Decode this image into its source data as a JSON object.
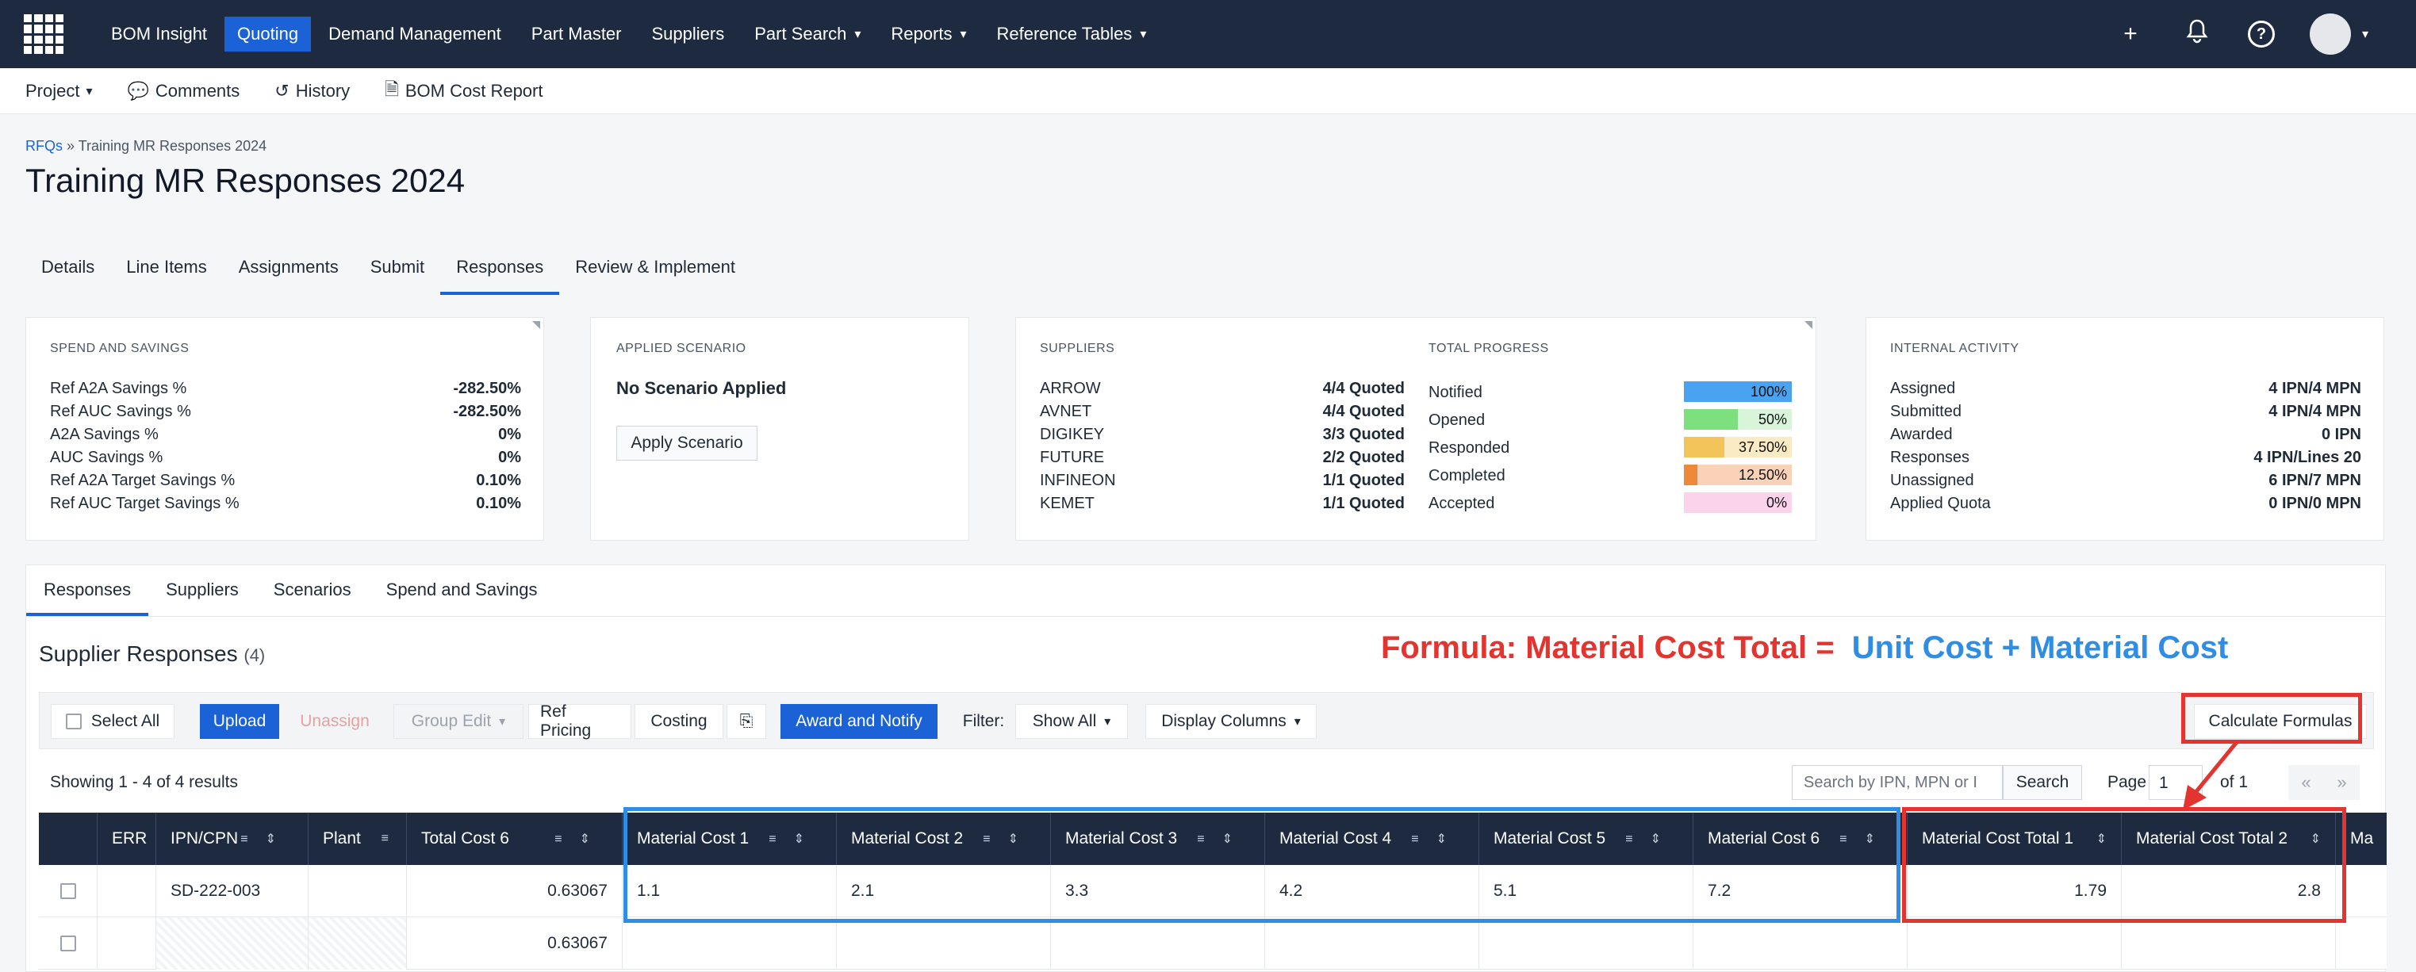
{
  "nav": {
    "items": [
      {
        "label": "BOM Insight",
        "chev": ""
      },
      {
        "label": "Quoting",
        "chev": ""
      },
      {
        "label": "Demand Management",
        "chev": ""
      },
      {
        "label": "Part Master",
        "chev": ""
      },
      {
        "label": "Suppliers",
        "chev": ""
      },
      {
        "label": "Part Search",
        "chev": "⌄"
      },
      {
        "label": "Reports",
        "chev": "⌄"
      },
      {
        "label": "Reference Tables",
        "chev": "⌄"
      }
    ],
    "active": "Quoting"
  },
  "subnav": {
    "project": "Project",
    "comments": "Comments",
    "history": "History",
    "bom_cost_report": "BOM Cost Report"
  },
  "breadcrumb": {
    "root": "RFQs",
    "sep": " » ",
    "current": "Training MR Responses 2024"
  },
  "title": "Training MR Responses 2024",
  "page_tabs": [
    "Details",
    "Line Items",
    "Assignments",
    "Submit",
    "Responses",
    "Review & Implement"
  ],
  "spend": {
    "heading": "SPEND AND SAVINGS",
    "rows": [
      {
        "k": "Ref A2A Savings %",
        "v": "-282.50%"
      },
      {
        "k": "Ref AUC Savings %",
        "v": "-282.50%"
      },
      {
        "k": "A2A Savings %",
        "v": "0%"
      },
      {
        "k": "AUC Savings %",
        "v": "0%"
      },
      {
        "k": "Ref A2A Target Savings %",
        "v": "0.10%"
      },
      {
        "k": "Ref AUC Target Savings %",
        "v": "0.10%"
      }
    ]
  },
  "scenario": {
    "heading": "APPLIED SCENARIO",
    "status": "No Scenario Applied",
    "button": "Apply Scenario"
  },
  "suppliers": {
    "heading": "SUPPLIERS",
    "rows": [
      {
        "k": "ARROW",
        "v": "4/4 Quoted"
      },
      {
        "k": "AVNET",
        "v": "4/4 Quoted"
      },
      {
        "k": "DIGIKEY",
        "v": "3/3 Quoted"
      },
      {
        "k": "FUTURE",
        "v": "2/2 Quoted"
      },
      {
        "k": "INFINEON",
        "v": "1/1 Quoted"
      },
      {
        "k": "KEMET",
        "v": "1/1 Quoted"
      }
    ]
  },
  "progress": {
    "heading": "TOTAL PROGRESS",
    "rows": [
      {
        "k": "Notified",
        "label": "100%",
        "pct": 100,
        "color": "#4aa3f0",
        "bg": "#dbeafe"
      },
      {
        "k": "Opened",
        "label": "50%",
        "pct": 50,
        "color": "#7ddf7d",
        "bg": "#d9f5d9"
      },
      {
        "k": "Responded",
        "label": "37.50%",
        "pct": 37.5,
        "color": "#f2c45a",
        "bg": "#fbebc4"
      },
      {
        "k": "Completed",
        "label": "12.50%",
        "pct": 12.5,
        "color": "#f0883a",
        "bg": "#f9d2b8"
      },
      {
        "k": "Accepted",
        "label": "0%",
        "pct": 0,
        "color": "#f7b6dd",
        "bg": "#fbd3ea"
      }
    ]
  },
  "internal": {
    "heading": "INTERNAL ACTIVITY",
    "rows": [
      {
        "k": "Assigned",
        "v": "4 IPN/4 MPN"
      },
      {
        "k": "Submitted",
        "v": "4 IPN/4 MPN"
      },
      {
        "k": "Awarded",
        "v": "0 IPN"
      },
      {
        "k": "Responses",
        "v": "4 IPN/Lines 20"
      },
      {
        "k": "Unassigned",
        "v": "6 IPN/7 MPN"
      },
      {
        "k": "Applied Quota",
        "v": "0 IPN/0 MPN"
      }
    ]
  },
  "sub_tabs": [
    "Responses",
    "Suppliers",
    "Scenarios",
    "Spend and Savings"
  ],
  "section": {
    "title": "Supplier Responses",
    "count": "(4)"
  },
  "formula": {
    "left": "Formula: Material Cost Total =",
    "right": "Unit Cost + Material Cost"
  },
  "toolbar": {
    "select_all": "Select All",
    "upload": "Upload",
    "unassign": "Unassign",
    "group_edit": "Group Edit",
    "ref_pricing": "Ref Pricing",
    "costing": "Costing",
    "award": "Award and Notify",
    "filter_label": "Filter:",
    "filter_value": "Show All",
    "display_columns": "Display Columns",
    "calculate": "Calculate Formulas"
  },
  "results": {
    "showing": "Showing 1 - 4 of 4 results",
    "search_placeholder": "Search by IPN, MPN or I",
    "search_btn": "Search",
    "page_label": "Page",
    "page_value": "1",
    "of": "of 1",
    "prev": "«",
    "next": "»"
  },
  "table": {
    "columns": [
      "ERR",
      "IPN/CPN",
      "Plant",
      "Total Cost 6",
      "Material Cost 1",
      "Material Cost 2",
      "Material Cost 3",
      "Material Cost 4",
      "Material Cost 5",
      "Material Cost 6",
      "Material Cost Total 1",
      "Material Cost Total 2",
      "Ma"
    ],
    "rows": [
      {
        "ipn": "SD-222-003",
        "total": "0.63067",
        "mc": [
          "1.1",
          "2.1",
          "3.3",
          "4.2",
          "5.1",
          "7.2"
        ],
        "mct": [
          "1.79",
          "2.8"
        ]
      },
      {
        "ipn": "",
        "total": "0.63067",
        "mc": [
          "",
          "",
          "",
          "",
          "",
          ""
        ],
        "mct": [
          "",
          ""
        ]
      }
    ]
  }
}
